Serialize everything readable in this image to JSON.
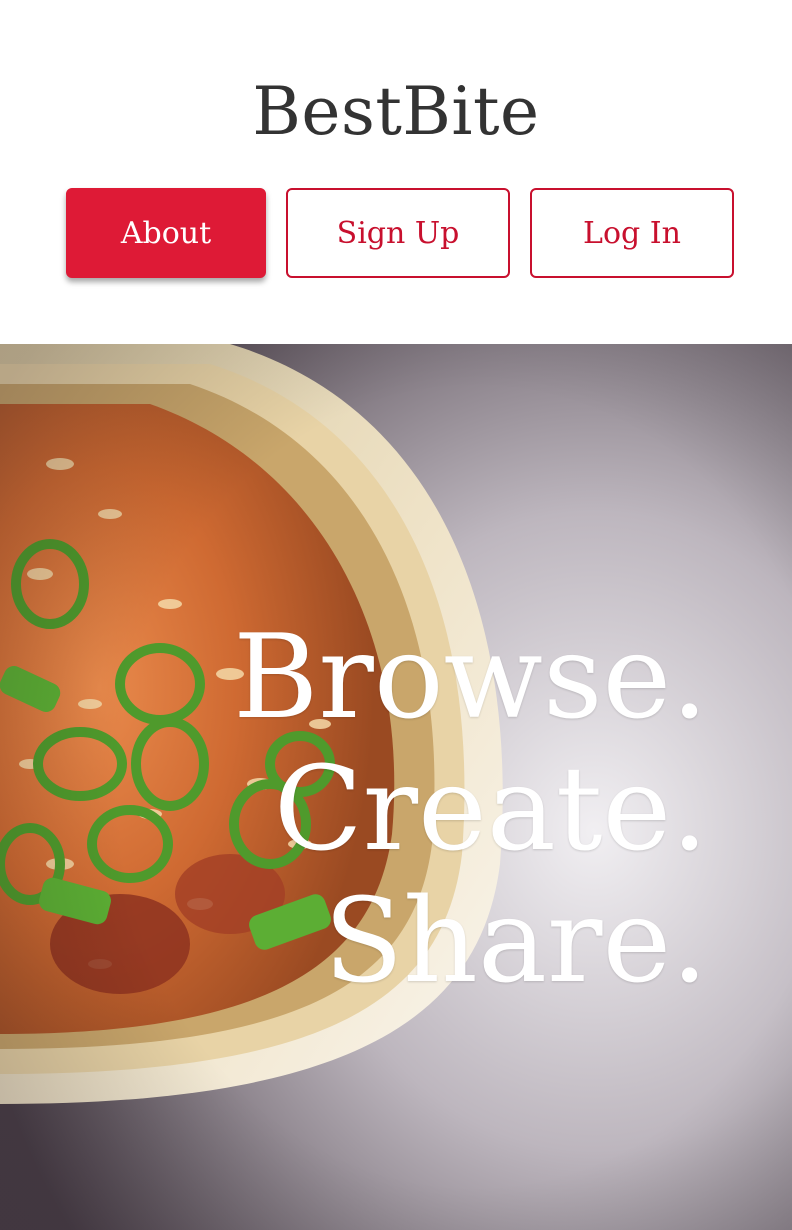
{
  "brand": {
    "name": "BestBite"
  },
  "nav": {
    "about_label": "About",
    "signup_label": "Sign Up",
    "login_label": "Log In"
  },
  "hero": {
    "lines": [
      "Browse.",
      "Create.",
      "Share."
    ]
  },
  "colors": {
    "accent": "#de1a36",
    "accent_outline": "#c8102e",
    "brand_text": "#333333"
  }
}
